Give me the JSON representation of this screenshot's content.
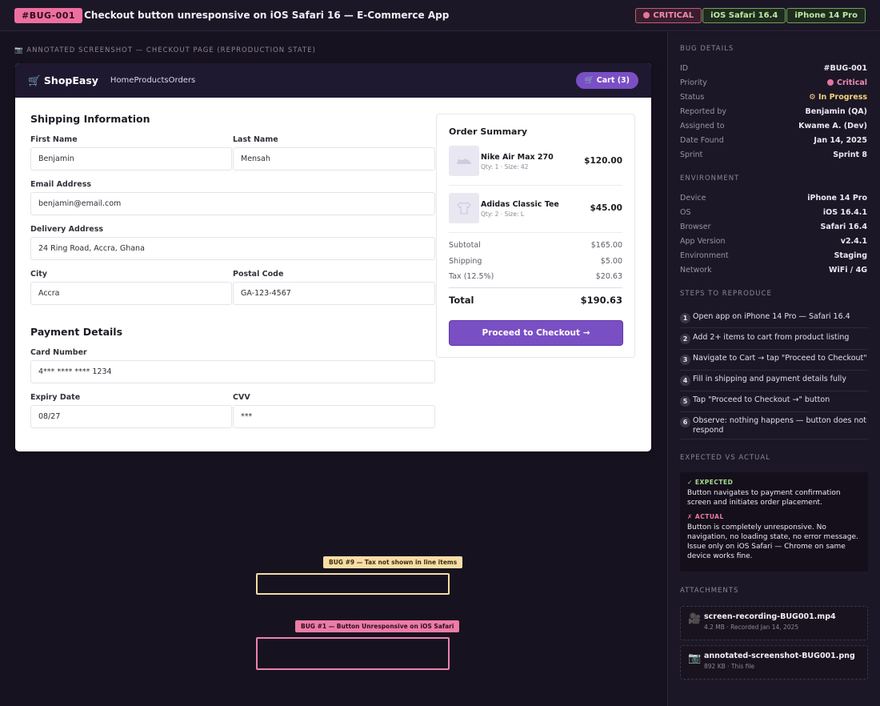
{
  "header": {
    "bug_id": "#BUG-001",
    "title": "Checkout button unresponsive on iOS Safari 16 — E-Commerce App",
    "tags": [
      "CRITICAL",
      "iOS Safari 16.4",
      "iPhone 14 Pro"
    ]
  },
  "caption": "📷 ANNOTATED SCREENSHOT — CHECKOUT PAGE (REPRODUCTION STATE)",
  "app": {
    "logo": "🛒 ShopEasy",
    "nav": [
      "Home",
      "Products",
      "Orders"
    ],
    "cart": "🛒 Cart (3)",
    "shipping": {
      "title": "Shipping Information",
      "first_name_label": "First Name",
      "first_name": "Benjamin",
      "last_name_label": "Last Name",
      "last_name": "Mensah",
      "email_label": "Email Address",
      "email": "benjamin@email.com",
      "address_label": "Delivery Address",
      "address": "24 Ring Road, Accra, Ghana",
      "city_label": "City",
      "city": "Accra",
      "postal_label": "Postal Code",
      "postal": "GA-123-4567"
    },
    "payment": {
      "title": "Payment Details",
      "card_label": "Card Number",
      "card": "4*** **** **** 1234",
      "expiry_label": "Expiry Date",
      "expiry": "08/27",
      "cvv_label": "CVV",
      "cvv": "***"
    },
    "summary": {
      "title": "Order Summary",
      "items": [
        {
          "name": "Nike Air Max 270",
          "meta": "Qty: 1 · Size: 42",
          "price": "$120.00",
          "icon": "shoe-icon"
        },
        {
          "name": "Adidas Classic Tee",
          "meta": "Qty: 2 · Size: L",
          "price": "$45.00",
          "icon": "shirt-icon"
        }
      ],
      "subtotal_label": "Subtotal",
      "subtotal": "$165.00",
      "shipping_label": "Shipping",
      "shipping": "$5.00",
      "tax_label": "Tax (12.5%)",
      "tax": "$20.63",
      "total_label": "Total",
      "total": "$190.63",
      "checkout_label": "Proceed to Checkout →"
    }
  },
  "annotations": [
    {
      "label": "BUG #9 — Tax not shown in line items",
      "color": "#f8dea5"
    },
    {
      "label": "BUG #1 — Button Unresponsive on iOS Safari",
      "color": "#ee7ba8"
    }
  ],
  "sidebar": {
    "bug_details_title": "BUG DETAILS",
    "details": [
      {
        "label": "ID",
        "value": "#BUG-001"
      },
      {
        "label": "Priority",
        "value": "Critical"
      },
      {
        "label": "Status",
        "value": "⚙ In Progress"
      },
      {
        "label": "Reported by",
        "value": "Benjamin (QA)"
      },
      {
        "label": "Assigned to",
        "value": "Kwame A. (Dev)"
      },
      {
        "label": "Date Found",
        "value": "Jan 14, 2025"
      },
      {
        "label": "Sprint",
        "value": "Sprint 8"
      }
    ],
    "environment_title": "ENVIRONMENT",
    "environment": [
      {
        "label": "Device",
        "value": "iPhone 14 Pro"
      },
      {
        "label": "OS",
        "value": "iOS 16.4.1"
      },
      {
        "label": "Browser",
        "value": "Safari 16.4"
      },
      {
        "label": "App Version",
        "value": "v2.4.1"
      },
      {
        "label": "Environment",
        "value": "Staging"
      },
      {
        "label": "Network",
        "value": "WiFi / 4G"
      }
    ],
    "steps_title": "STEPS TO REPRODUCE",
    "steps": [
      "Open app on iPhone 14 Pro — Safari 16.4",
      "Add 2+ items to cart from product listing",
      "Navigate to Cart → tap \"Proceed to Checkout\"",
      "Fill in shipping and payment details fully",
      "Tap \"Proceed to Checkout →\" button",
      "Observe: nothing happens — button does not respond"
    ],
    "expected_actual_title": "EXPECTED VS ACTUAL",
    "expected_head": "✓ EXPECTED",
    "expected_text": "Button navigates to payment confirmation screen and initiates order placement.",
    "actual_head": "✗ ACTUAL",
    "actual_text": "Button is completely unresponsive. No navigation, no loading state, no error message. Issue only on iOS Safari — Chrome on same device works fine.",
    "attachments_title": "ATTACHMENTS",
    "attachments": [
      {
        "name": "screen-recording-BUG001.mp4",
        "meta": "4.2 MB · Recorded Jan 14, 2025",
        "icon": "🎥"
      },
      {
        "name": "annotated-screenshot-BUG001.png",
        "meta": "892 KB · This file",
        "icon": "📷"
      }
    ]
  }
}
